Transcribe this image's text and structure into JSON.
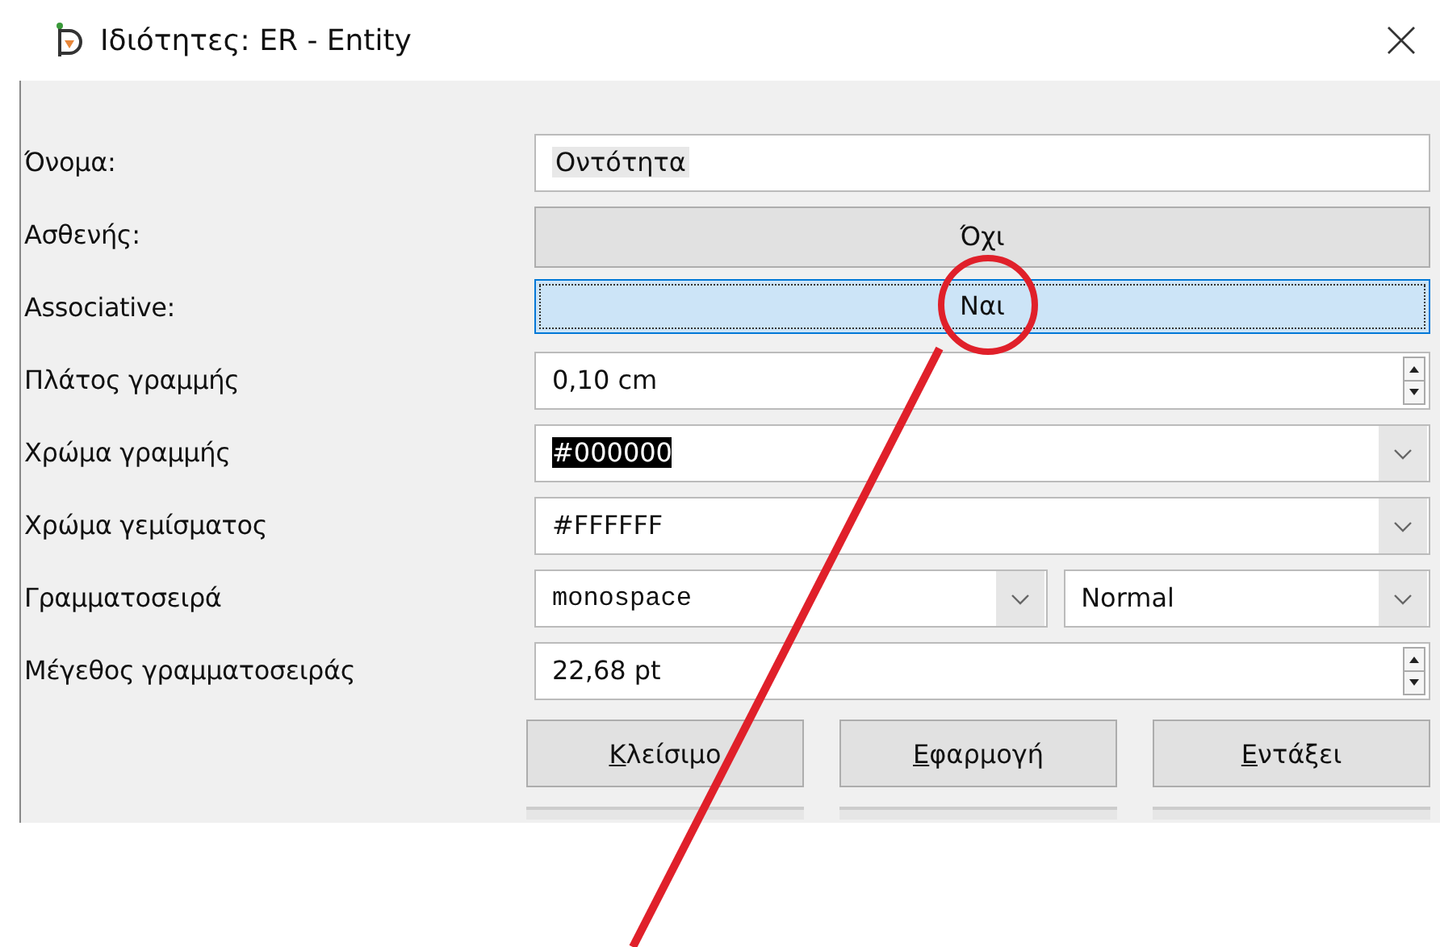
{
  "window": {
    "title": "Ιδιότητες: ER - Entity"
  },
  "rows": [
    {
      "kind": "text",
      "label": "Όνομα:",
      "value": "Οντότητα"
    },
    {
      "kind": "toggle",
      "label": "Ασθενής:",
      "value": "Όχι",
      "focused": false
    },
    {
      "kind": "toggle",
      "label": "Associative:",
      "value": "Ναι",
      "focused": true
    },
    {
      "kind": "spin",
      "label": "Πλάτος γραμμής",
      "value": "0,10 cm"
    },
    {
      "kind": "combo",
      "label": "Χρώμα γραμμής",
      "value": "#000000",
      "selected": true
    },
    {
      "kind": "combo",
      "label": "Χρώμα γεμίσματος",
      "value": "#FFFFFF",
      "selected": false
    },
    {
      "kind": "font",
      "label": "Γραμματοσειρά",
      "value": "monospace",
      "style": "Normal"
    },
    {
      "kind": "spin",
      "label": "Μέγεθος γραμματοσειράς",
      "value": "22,68 pt"
    }
  ],
  "buttons": [
    {
      "key": "Κ",
      "rest": "λείσιμο"
    },
    {
      "key": "Ε",
      "rest": "φαρμογή"
    },
    {
      "key": "Ε",
      "rest": "ντάξει"
    }
  ]
}
